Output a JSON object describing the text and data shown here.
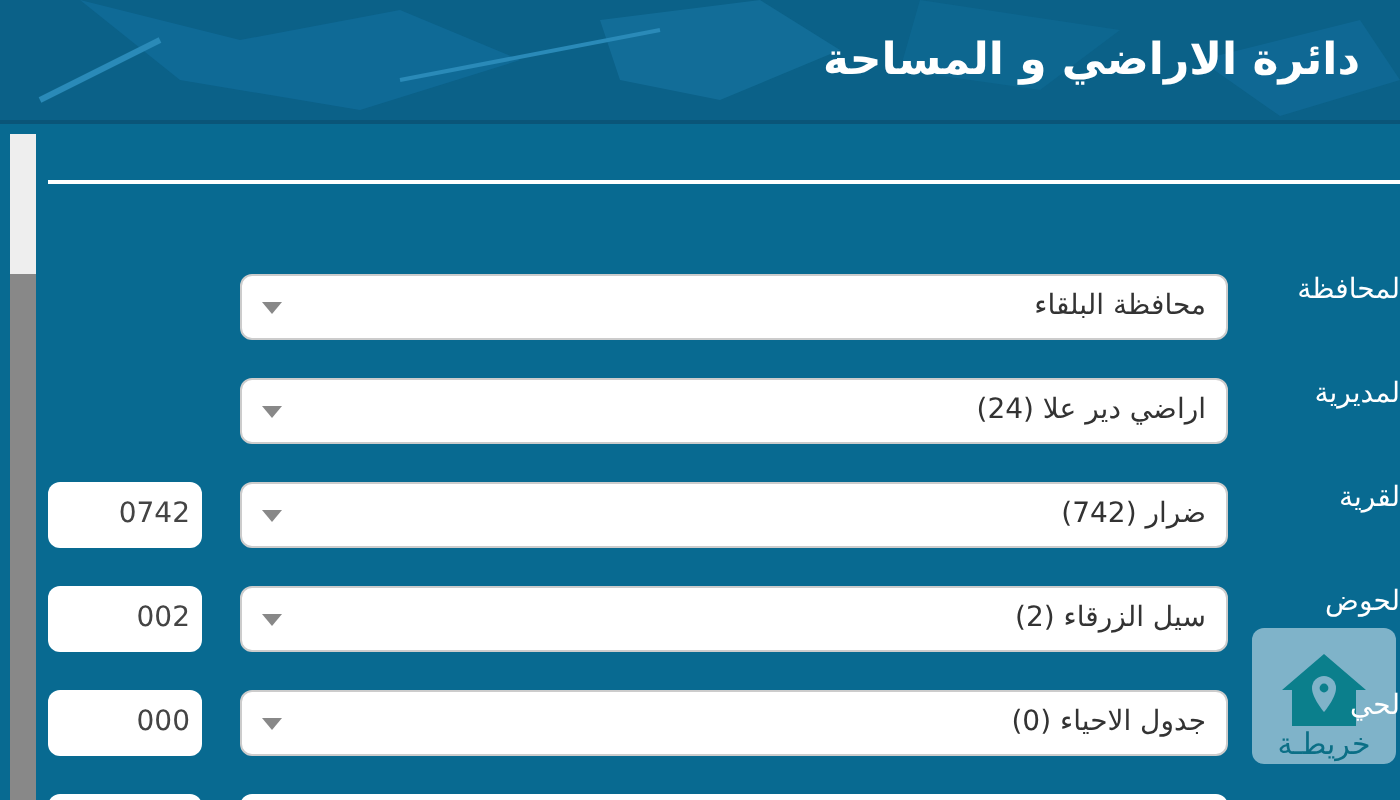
{
  "header": {
    "title": "دائرة الاراضي و المساحة"
  },
  "rows": [
    {
      "label": "لمحافظة",
      "value": "محافظة البلقاء"
    },
    {
      "label": "لمديرية",
      "value": "اراضي دير علا (24)"
    },
    {
      "label": "لقرية",
      "value": "ضرار (742)",
      "code": "0742"
    },
    {
      "label": "لحوض",
      "value": "سيل الزرقاء (2)",
      "code": "002"
    },
    {
      "label": "لحي",
      "value": "جدول الاحياء (0)",
      "code": "000"
    }
  ],
  "map_button": {
    "label": "خريطـة"
  }
}
